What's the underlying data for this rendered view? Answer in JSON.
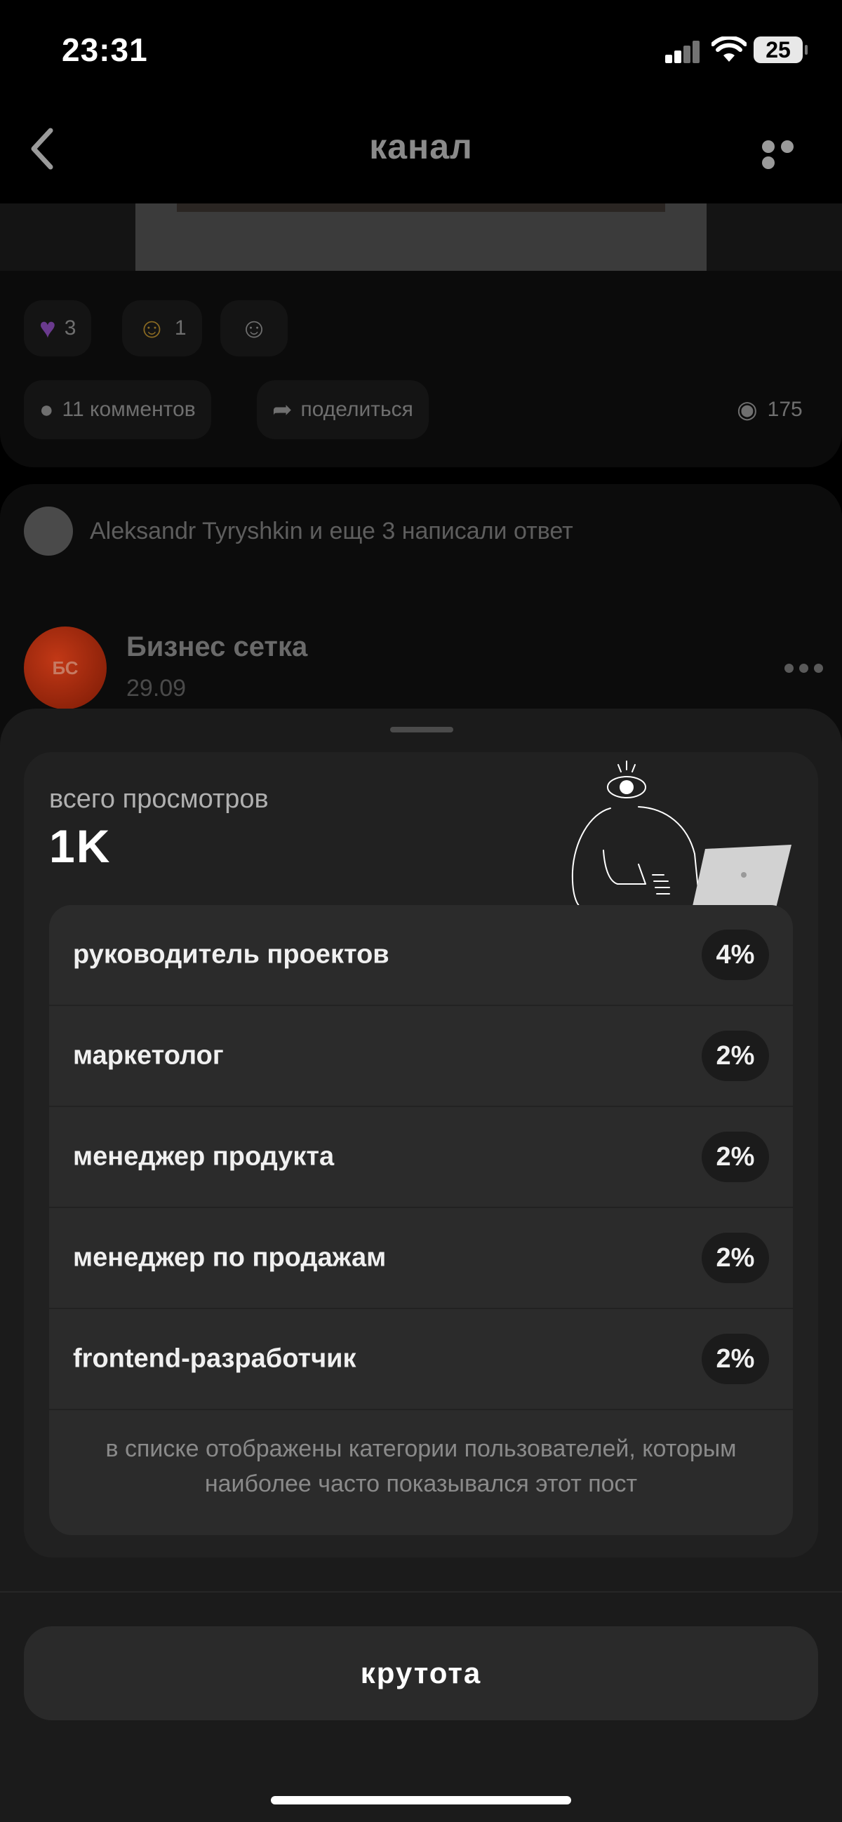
{
  "status_bar": {
    "time": "23:31",
    "battery": "25"
  },
  "header": {
    "title": "канал"
  },
  "post": {
    "reactions": [
      {
        "icon": "purple-heart-icon",
        "count": "3"
      },
      {
        "icon": "grinning-face-icon",
        "count": "1"
      }
    ],
    "comments_label": "11 комментов",
    "share_label": "поделиться",
    "views_count": "175"
  },
  "reply_summary": "Aleksandr Tyryshkin и еще 3 написали ответ",
  "next_post": {
    "avatar_initials": "БС",
    "author": "Бизнес сетка",
    "date": "29.09"
  },
  "sheet": {
    "views_label": "всего просмотров",
    "views_total": "1K",
    "categories": [
      {
        "label": "руководитель проектов",
        "percent": "4%"
      },
      {
        "label": "маркетолог",
        "percent": "2%"
      },
      {
        "label": "менеджер продукта",
        "percent": "2%"
      },
      {
        "label": "менеджер по продажам",
        "percent": "2%"
      },
      {
        "label": "frontend-разработчик",
        "percent": "2%"
      }
    ],
    "note": "в списке отображены категории пользователей, которым наиболее часто показывался этот пост",
    "button_label": "крутота"
  }
}
